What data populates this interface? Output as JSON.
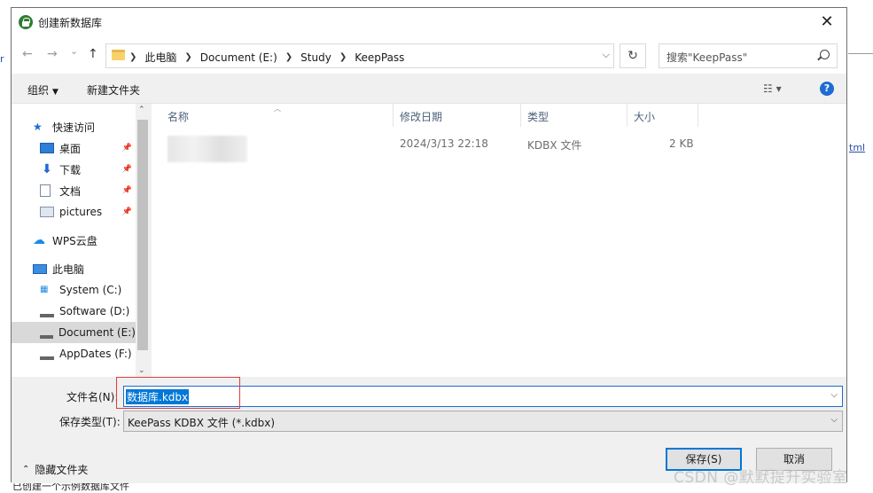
{
  "background": {
    "link_fragment": "tml",
    "left_fragment": "r",
    "bottom_text": "已创建一个示例数据库文件"
  },
  "watermark": "CSDN @默默提升实验室",
  "dialog": {
    "title": "创建新数据库",
    "close": "✕"
  },
  "nav": {
    "back": "←",
    "forward": "→",
    "recent": "⌄",
    "up": "↑",
    "breadcrumbs": [
      "此电脑",
      "Document (E:)",
      "Study",
      "KeepPass"
    ],
    "refresh": "↻",
    "search_placeholder": "搜索\"KeepPass\""
  },
  "toolbar": {
    "organize": "组织",
    "new_folder": "新建文件夹",
    "view_icon": "☷ ▾",
    "help": "?"
  },
  "sidebar": {
    "quick_access": "快速访问",
    "items": [
      {
        "label": "桌面",
        "pinned": true
      },
      {
        "label": "下载",
        "pinned": true
      },
      {
        "label": "文档",
        "pinned": true
      },
      {
        "label": "pictures",
        "pinned": true
      }
    ],
    "wps": "WPS云盘",
    "this_pc": "此电脑",
    "drives": [
      {
        "label": "System (C:)"
      },
      {
        "label": "Software (D:)"
      },
      {
        "label": "Document (E:)",
        "selected": true
      },
      {
        "label": "AppDates (F:)"
      }
    ]
  },
  "filelist": {
    "columns": [
      "名称",
      "修改日期",
      "类型",
      "大小"
    ],
    "rows": [
      {
        "name": "",
        "modified": "2024/3/13 22:18",
        "type": "KDBX 文件",
        "size": "2 KB"
      }
    ]
  },
  "form": {
    "filename_label": "文件名(N):",
    "filename_value": "数据库.kdbx",
    "filetype_label": "保存类型(T):",
    "filetype_value": "KeePass KDBX 文件 (*.kdbx)",
    "hide_folders": "隐藏文件夹",
    "save": "保存(S)",
    "cancel": "取消"
  }
}
